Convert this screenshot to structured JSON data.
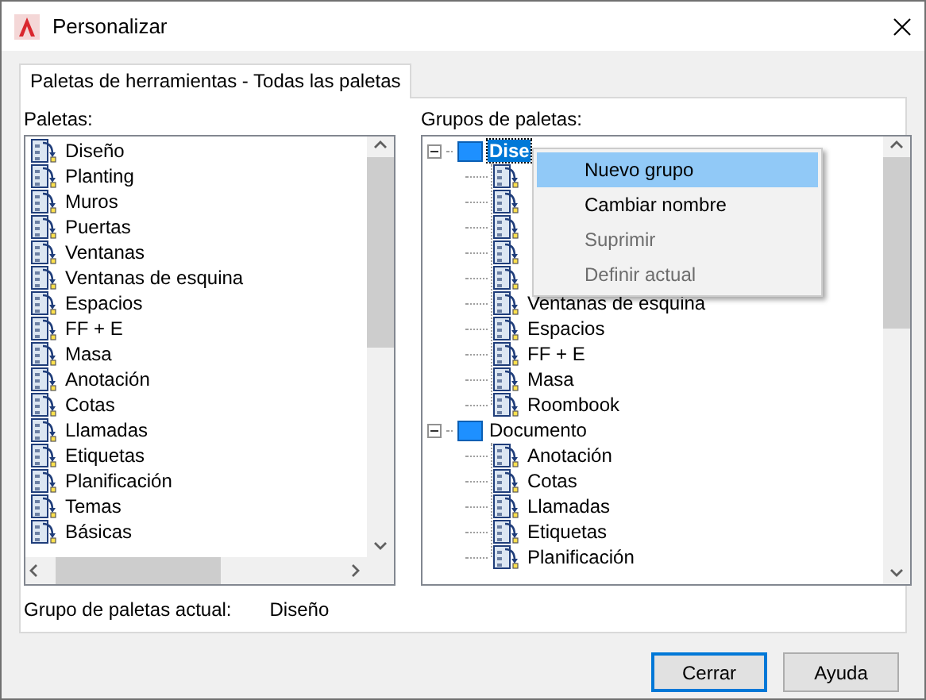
{
  "window": {
    "title": "Personalizar"
  },
  "tabs": [
    {
      "label": "Paletas de herramientas - Todas las paletas",
      "selected": true
    }
  ],
  "palettes": {
    "label": "Paletas:",
    "items": [
      "Diseño",
      "Planting",
      "Muros",
      "Puertas",
      "Ventanas",
      "Ventanas de esquina",
      "Espacios",
      "FF + E",
      "Masa",
      "Anotación",
      "Cotas",
      "Llamadas",
      "Etiquetas",
      "Planificación",
      "Temas",
      "Básicas"
    ]
  },
  "groups": {
    "label": "Grupos de paletas:",
    "tree": [
      {
        "label": "Dise",
        "selected": true,
        "expanded": true,
        "children": [
          {
            "kind": "covered"
          },
          {
            "kind": "covered"
          },
          {
            "kind": "covered"
          },
          {
            "kind": "covered"
          },
          {
            "kind": "covered"
          },
          {
            "kind": "palette",
            "label": "Ventanas de esquina"
          },
          {
            "kind": "palette",
            "label": "Espacios"
          },
          {
            "kind": "palette",
            "label": "FF + E"
          },
          {
            "kind": "palette",
            "label": "Masa"
          },
          {
            "kind": "palette",
            "label": "Roombook"
          }
        ]
      },
      {
        "label": "Documento",
        "selected": false,
        "expanded": true,
        "children": [
          {
            "kind": "palette",
            "label": "Anotación"
          },
          {
            "kind": "palette",
            "label": "Cotas"
          },
          {
            "kind": "palette",
            "label": "Llamadas"
          },
          {
            "kind": "palette",
            "label": "Etiquetas"
          },
          {
            "kind": "palette",
            "label": "Planificación"
          }
        ]
      }
    ]
  },
  "context_menu": [
    {
      "label": "Nuevo grupo",
      "selected": true,
      "disabled": false
    },
    {
      "label": "Cambiar nombre",
      "selected": false,
      "disabled": false
    },
    {
      "label": "Suprimir",
      "selected": false,
      "disabled": true
    },
    {
      "label": "Definir actual",
      "selected": false,
      "disabled": true
    }
  ],
  "current_group": {
    "label": "Grupo de paletas actual:",
    "value": "Diseño"
  },
  "buttons": [
    {
      "label": "Cerrar",
      "selected": true
    },
    {
      "label": "Ayuda",
      "selected": false
    }
  ]
}
